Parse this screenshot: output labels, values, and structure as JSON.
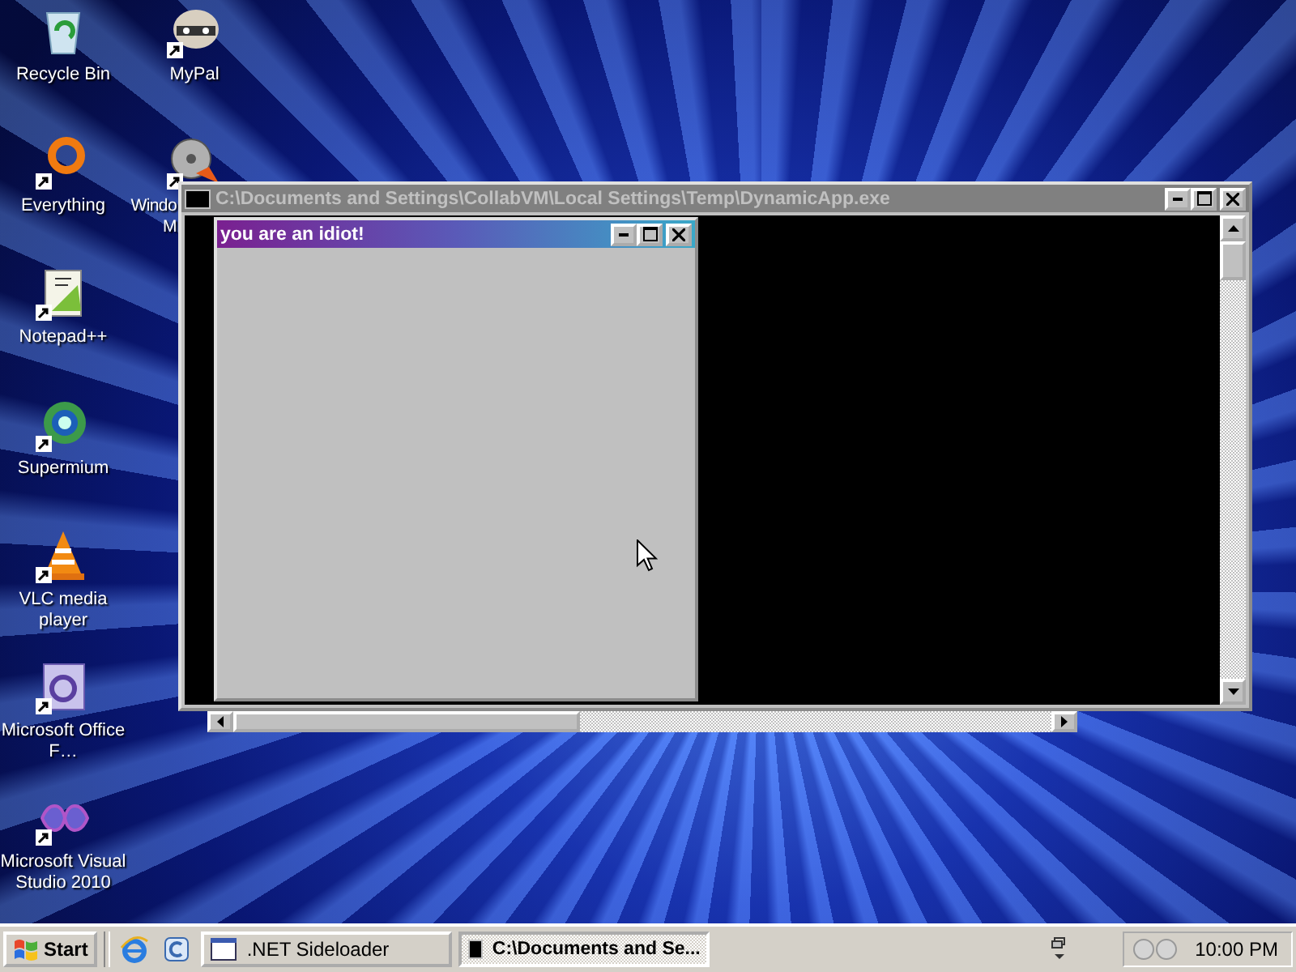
{
  "desktop_columns": [
    [
      {
        "label": "Recycle Bin",
        "kind": "recycle",
        "shortcut": false
      },
      {
        "label": "Everything",
        "kind": "ring",
        "shortcut": true
      },
      {
        "label": "Notepad++",
        "kind": "notepad",
        "shortcut": true
      },
      {
        "label": "Supermium",
        "kind": "globe",
        "shortcut": true
      },
      {
        "label": "VLC media player",
        "kind": "cone",
        "shortcut": true
      },
      {
        "label": "Microsoft Office F…",
        "kind": "office",
        "shortcut": true
      },
      {
        "label": "Microsoft Visual Studio 2010",
        "kind": "infinity",
        "shortcut": true
      }
    ],
    [
      {
        "label": "MyPal",
        "kind": "raccoon",
        "shortcut": true
      },
      {
        "label": "Windo M",
        "kind": "film",
        "shortcut": true
      }
    ]
  ],
  "console_window": {
    "title": "C:\\Documents and Settings\\CollabVM\\Local Settings\\Temp\\DynamicApp.exe",
    "active": false
  },
  "dialog_window": {
    "title": "you are an idiot!",
    "active": true
  },
  "taskbar": {
    "start": "Start",
    "tasks": [
      {
        "label": ".NET Sideloader",
        "selected": false,
        "kind": "app"
      },
      {
        "label": "C:\\Documents and Se...",
        "selected": true,
        "kind": "console"
      }
    ],
    "clock": "10:00 PM"
  }
}
